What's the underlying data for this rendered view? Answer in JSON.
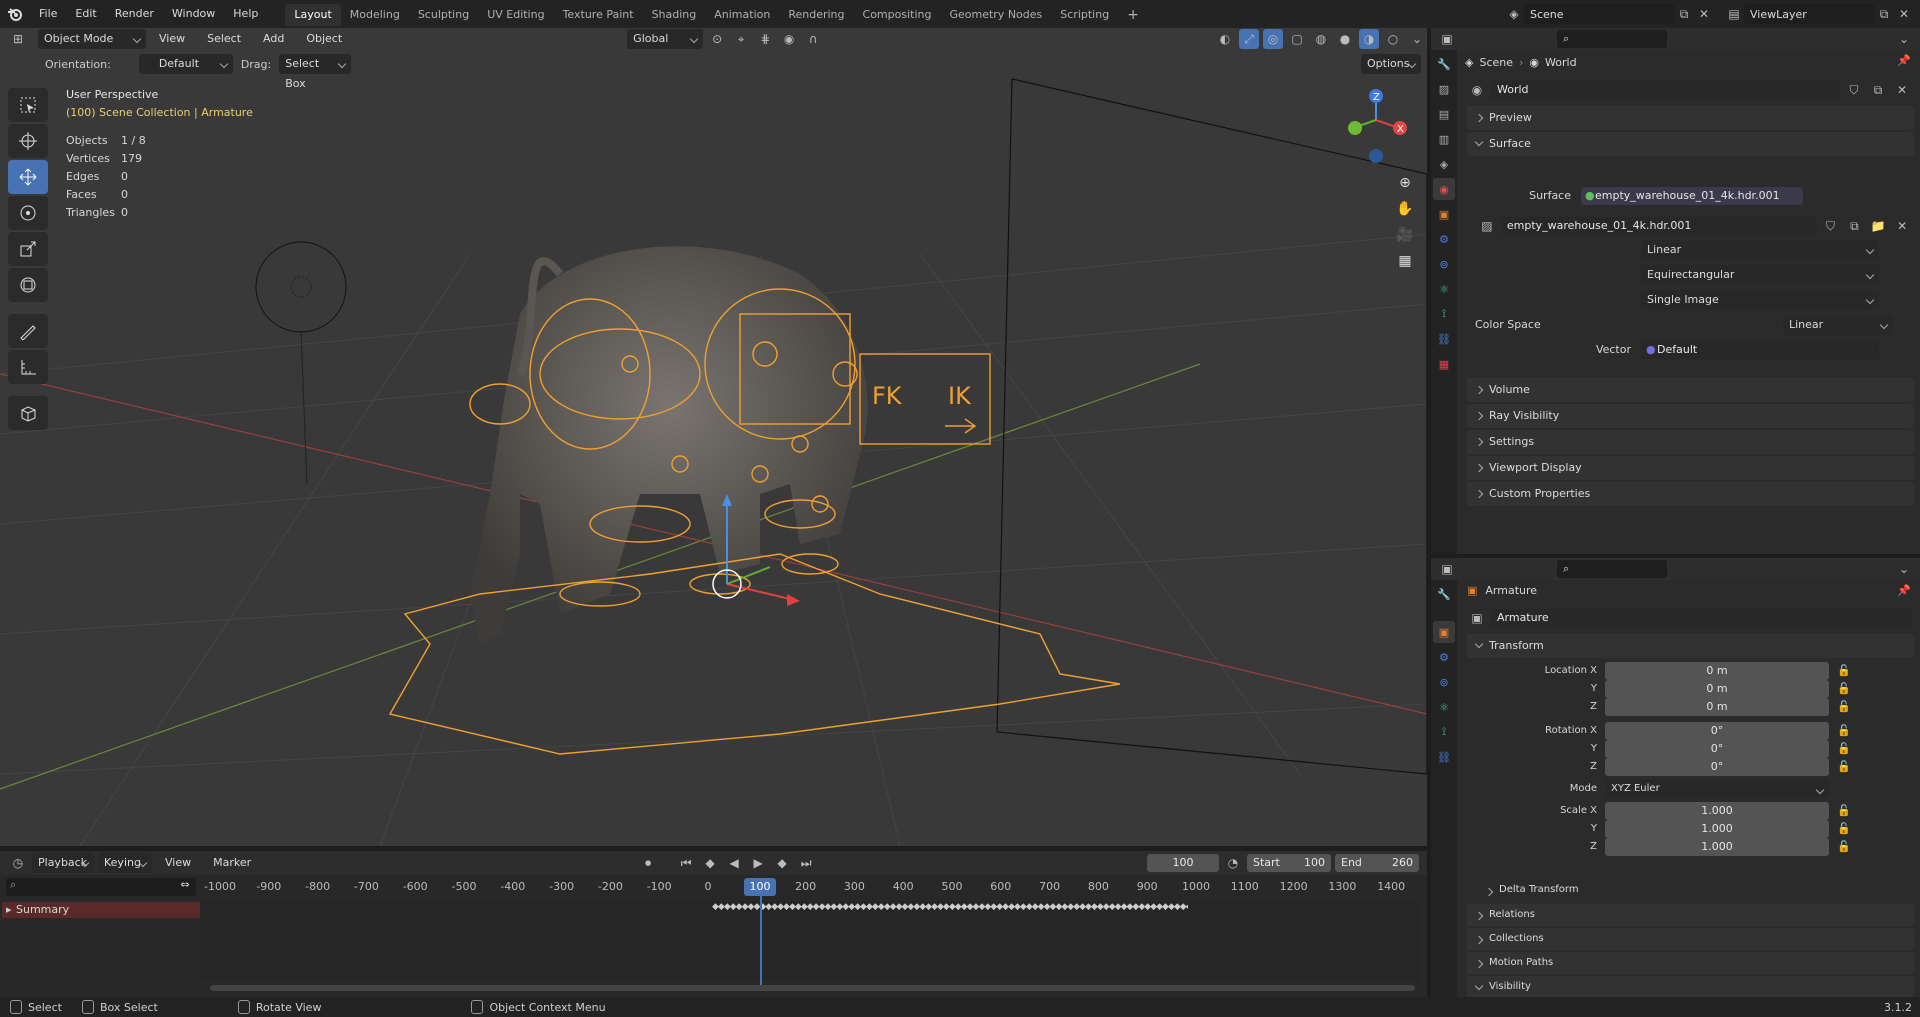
{
  "topbar": {
    "menus": [
      "File",
      "Edit",
      "Render",
      "Window",
      "Help"
    ],
    "tabs": [
      "Layout",
      "Modeling",
      "Sculpting",
      "UV Editing",
      "Texture Paint",
      "Shading",
      "Animation",
      "Rendering",
      "Compositing",
      "Geometry Nodes",
      "Scripting"
    ],
    "active_tab": "Layout",
    "scene_label": "Scene",
    "viewlayer_label": "ViewLayer"
  },
  "viewport_header": {
    "mode": "Object Mode",
    "menus": [
      "View",
      "Select",
      "Add",
      "Object"
    ],
    "transform": "Global",
    "orientation_label": "Orientation:",
    "orientation_value": "Default",
    "drag_label": "Drag:",
    "drag_value": "Select Box",
    "options_label": "Options"
  },
  "overlay": {
    "view_name": "User Perspective",
    "collection": "(100) Scene Collection | Armature",
    "stats": [
      {
        "label": "Objects",
        "value": "1 / 8"
      },
      {
        "label": "Vertices",
        "value": "179"
      },
      {
        "label": "Edges",
        "value": "0"
      },
      {
        "label": "Faces",
        "value": "0"
      },
      {
        "label": "Triangles",
        "value": "0"
      }
    ],
    "rig_text_fk": "FK",
    "rig_text_ik": "IK"
  },
  "world_panel": {
    "breadcrumb_scene": "Scene",
    "breadcrumb_world": "World",
    "world_name": "World",
    "sections_closed": [
      "Preview"
    ],
    "surface_section": "Surface",
    "surface_label": "Surface",
    "surface_value": "empty_warehouse_01_4k.hdr.001",
    "image_name": "empty_warehouse_01_4k.hdr.001",
    "interpolation": "Linear",
    "projection": "Equirectangular",
    "source": "Single Image",
    "color_space_label": "Color Space",
    "color_space_value": "Linear",
    "vector_label": "Vector",
    "vector_value": "Default",
    "sections_after": [
      "Volume",
      "Ray Visibility",
      "Settings",
      "Viewport Display",
      "Custom Properties"
    ]
  },
  "object_panel": {
    "header_name": "Armature",
    "object_name": "Armature",
    "transform_section": "Transform",
    "location": [
      {
        "label": "Location X",
        "value": "0 m"
      },
      {
        "label": "Y",
        "value": "0 m"
      },
      {
        "label": "Z",
        "value": "0 m"
      }
    ],
    "rotation": [
      {
        "label": "Rotation X",
        "value": "0°"
      },
      {
        "label": "Y",
        "value": "0°"
      },
      {
        "label": "Z",
        "value": "0°"
      }
    ],
    "mode_label": "Mode",
    "mode_value": "XYZ Euler",
    "scale": [
      {
        "label": "Scale X",
        "value": "1.000"
      },
      {
        "label": "Y",
        "value": "1.000"
      },
      {
        "label": "Z",
        "value": "1.000"
      }
    ],
    "delta_transform": "Delta Transform",
    "sections": [
      "Relations",
      "Collections",
      "Motion Paths",
      "Visibility"
    ]
  },
  "timeline": {
    "menus": [
      "Playback",
      "Keying",
      "View",
      "Marker"
    ],
    "current_frame": "100",
    "start_label": "Start",
    "start_value": "100",
    "end_label": "End",
    "end_value": "260",
    "ruler": [
      "-1000",
      "-900",
      "-800",
      "-700",
      "-600",
      "-500",
      "-400",
      "-300",
      "-200",
      "-100",
      "0",
      "100",
      "200",
      "300",
      "400",
      "500",
      "600",
      "700",
      "800",
      "900",
      "1000",
      "1100",
      "1200",
      "1300",
      "1400"
    ],
    "summary_label": "Summary"
  },
  "statusbar": {
    "select": "Select",
    "box_select": "Box Select",
    "rotate_view": "Rotate View",
    "context_menu": "Object Context Menu",
    "version": "3.1.2"
  },
  "colors": {
    "accent": "#4772b3",
    "rig_orange": "#f0a030",
    "active_text": "#e8d070"
  }
}
